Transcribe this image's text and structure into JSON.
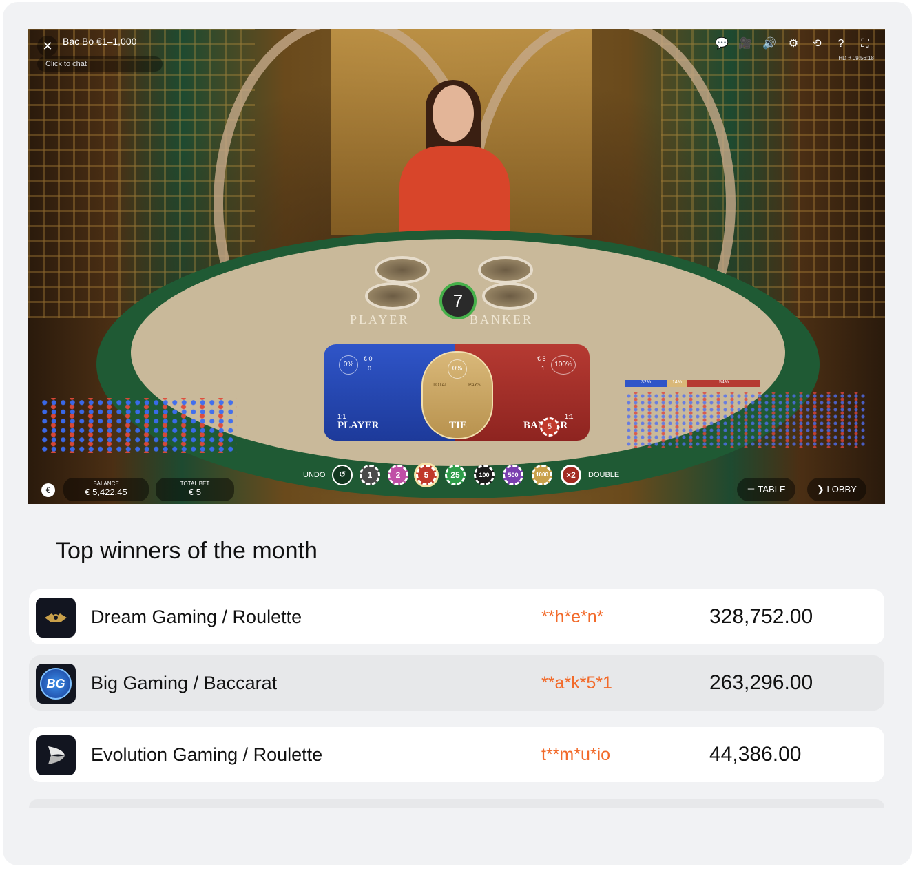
{
  "game": {
    "title": "Bac Bo €1–1,000",
    "chat_placeholder": "Click to chat",
    "hd_label": "HD",
    "clock": "# 09:56:18",
    "timer": "7",
    "felt": {
      "player": "PLAYER",
      "banker": "BANKER"
    },
    "player_zone": {
      "label": "PLAYER",
      "odds": "1:1",
      "pct": "0%",
      "amount": "€ 0",
      "players": "0"
    },
    "tie_zone": {
      "label": "TIE",
      "pct": "0%",
      "header_total": "TOTAL",
      "header_pays": "PAYS"
    },
    "banker_zone": {
      "label": "BANKER",
      "odds": "1:1",
      "pct": "100%",
      "amount": "€ 5",
      "players": "1",
      "chip": "5"
    },
    "stats": {
      "player_pct": "32%",
      "tie_pct": "14%",
      "banker_pct": "54%"
    },
    "balance": {
      "label": "BALANCE",
      "value": "€ 5,422.45"
    },
    "total_bet": {
      "label": "TOTAL BET",
      "value": "€ 5"
    },
    "undo_label": "UNDO",
    "double_label": "DOUBLE",
    "double_chip": "×2",
    "chips": [
      "1",
      "2",
      "5",
      "25",
      "100",
      "500",
      "1000"
    ],
    "table_button": "TABLE",
    "lobby_button": "LOBBY",
    "colors": {
      "player": "#2f55c8",
      "banker": "#b63a32",
      "tie": "#d9b879",
      "felt": "#1f5a34"
    }
  },
  "section": {
    "title": "Top winners of the month"
  },
  "winners": [
    {
      "game": "Dream Gaming / Roulette",
      "user": "**h*e*n*",
      "amount": "328,752.00",
      "logo": "dream-gaming-logo"
    },
    {
      "game": "Big Gaming / Baccarat",
      "user": "**a*k*5*1",
      "amount": "263,296.00",
      "logo": "big-gaming-logo",
      "logo_text": "BG"
    },
    {
      "game": "Evolution Gaming / Roulette",
      "user": "t**m*u*io",
      "amount": "44,386.00",
      "logo": "evolution-gaming-logo"
    }
  ],
  "accent_color": "#f26a2a"
}
